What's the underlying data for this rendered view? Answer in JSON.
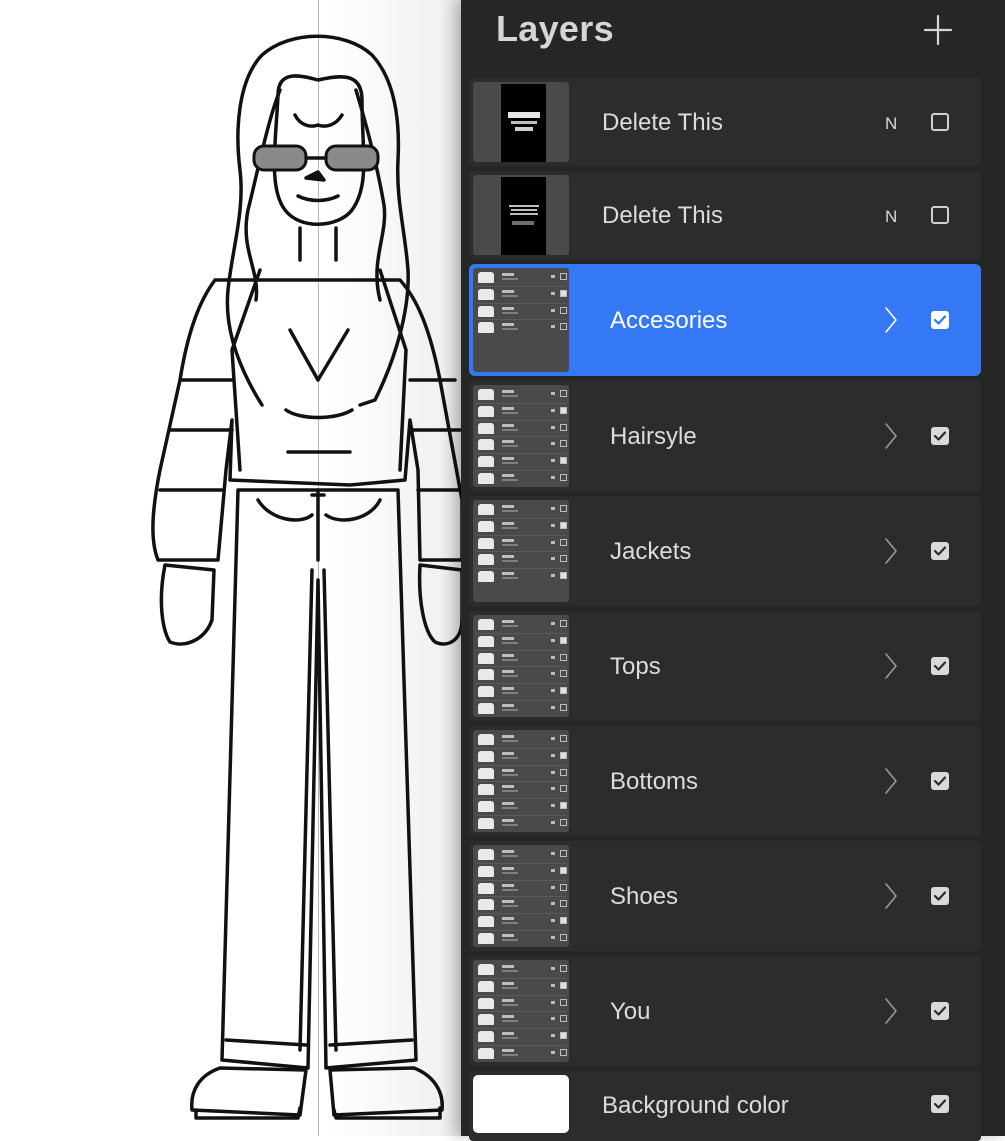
{
  "panel": {
    "title": "Layers",
    "add_icon": "plus-icon"
  },
  "layers": [
    {
      "name": "Delete This",
      "blend": "N",
      "visible": false,
      "kind": "layer",
      "thumb": "poster-dark-1"
    },
    {
      "name": "Delete This",
      "blend": "N",
      "visible": false,
      "kind": "layer",
      "thumb": "poster-dark-2"
    },
    {
      "name": "Accesories",
      "visible": true,
      "kind": "group",
      "selected": true,
      "mini_count": 4
    },
    {
      "name": "Hairsyle",
      "visible": true,
      "kind": "group",
      "mini_count": 6
    },
    {
      "name": "Jackets",
      "visible": true,
      "kind": "group",
      "mini_count": 5
    },
    {
      "name": "Tops",
      "visible": true,
      "kind": "group",
      "mini_count": 6
    },
    {
      "name": "Bottoms",
      "visible": true,
      "kind": "group",
      "mini_count": 6
    },
    {
      "name": "Shoes",
      "visible": true,
      "kind": "group",
      "mini_count": 6
    },
    {
      "name": "You",
      "visible": true,
      "kind": "group",
      "mini_count": 6
    },
    {
      "name": "Background color",
      "visible": true,
      "kind": "background",
      "thumb_color": "#ffffff"
    }
  ],
  "colors": {
    "panel_bg": "#262626",
    "row_bg": "#2c2c2c",
    "selected_bg": "#3478f6",
    "text": "#dcdcdc"
  },
  "icons": {
    "chevron": "chevron-right-icon",
    "checkbox_on": "checkbox-checked-icon",
    "checkbox_off": "checkbox-empty-icon"
  }
}
